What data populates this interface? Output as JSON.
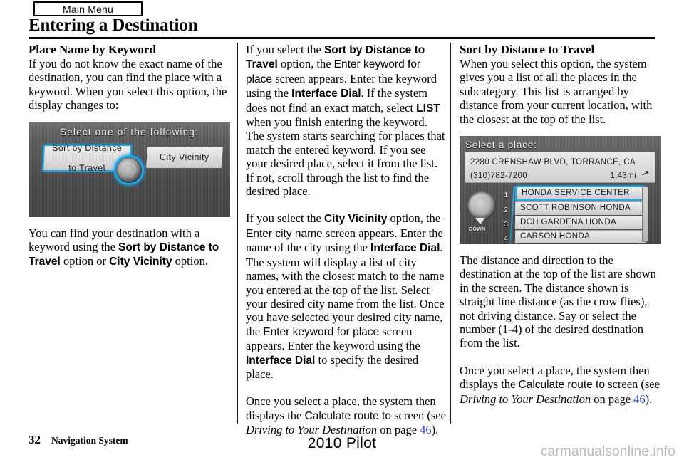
{
  "header": {
    "tab_label": "Main Menu",
    "title": "Entering a Destination"
  },
  "columns": {
    "left": {
      "heading": "Place Name by Keyword",
      "intro": "If you do not know the exact name of the destination, you can find the place with a keyword. When you select this option, the display changes to:",
      "after_1": "You can find your destination with a",
      "after_2": "keyword using the",
      "after_ui_1": "Sort by Distance to Travel",
      "after_3": "option or",
      "after_ui_2": "City Vicinity",
      "after_4": "option."
    },
    "middle": {
      "p1_a": "If you select the",
      "p1_ui1": "Sort by Distance to Travel",
      "p1_b": "option, the",
      "p1_ui2": "Enter keyword for place",
      "p1_c": "screen appears. Enter the keyword using the",
      "p1_ui3": "Interface Dial",
      "p1_d": ". If the system does not find an exact match, select",
      "p1_ui4": "LIST",
      "p1_e": "when you finish entering the keyword. The system starts searching for places that match the entered keyword. If you see your desired place, select it from the list. If not, scroll through the list to find the desired place.",
      "p2_a": "If you select the",
      "p2_ui1": "City Vicinity",
      "p2_b": "option, the",
      "p2_ui2": "Enter city name",
      "p2_c": "screen appears. Enter the name of the city using the",
      "p2_ui3": "Interface Dial",
      "p2_d": ". The system will display a list of city names, with the closest match to the name you entered at the top of the list. Select your desired city name from the list. Once you have selected your desired city name, the",
      "p2_ui4": "Enter keyword for place",
      "p2_e": "screen appears. Enter the keyword using the",
      "p2_ui5": "Interface Dial",
      "p2_f": "to specify the desired place.",
      "p3_a": "Once you select a place, the system then displays the",
      "p3_ui1": "Calculate route to",
      "p3_b": "screen (see",
      "p3_ital": "Driving to Your Destination",
      "p3_c": "on page",
      "p3_link": "46",
      "p3_d": ")."
    },
    "right": {
      "heading": "Sort by Distance to Travel",
      "intro": "When you select this option, the system gives you a list of all the places in the subcategory. This list is arranged by distance from your current location, with the closest at the top of the list.",
      "after": "The distance and direction to the destination at the top of the list are shown in the screen. The distance shown is straight line distance (as the crow flies), not driving distance. Say or select the number (1-4) of the desired destination from the list.",
      "p3_a": "Once you select a place, the system then displays the",
      "p3_ui1": "Calculate route to",
      "p3_b": "screen (see",
      "p3_ital": "Driving to Your Destination",
      "p3_c": "on page",
      "p3_link": "46",
      "p3_d": ")."
    }
  },
  "nav_screen_1": {
    "header": "Select one of the following:",
    "option_left_line1": "Sort by Distance",
    "option_left_line2": "to Travel",
    "option_right": "City Vicinity"
  },
  "nav_screen_2": {
    "header": "Select a place:",
    "address": "2280 CRENSHAW BLVD, TORRANCE, CA",
    "phone": "(310)782-7200",
    "distance": "1,43mi",
    "direction_arrow": "↗",
    "down_label": "DOWN",
    "items": [
      {
        "num": "1",
        "label": "HONDA SERVICE CENTER",
        "selected": true
      },
      {
        "num": "2",
        "label": "SCOTT ROBINSON HONDA",
        "selected": false
      },
      {
        "num": "3",
        "label": "DCH GARDENA HONDA",
        "selected": false
      },
      {
        "num": "4",
        "label": "CARSON HONDA",
        "selected": false
      }
    ]
  },
  "footer": {
    "page_number": "32",
    "section": "Navigation System",
    "model": "2010 Pilot",
    "watermark": "carmanualsonline.info"
  },
  "colors": {
    "link": "#2b43c6",
    "highlight": "#1ea6e8",
    "watermark": "#b9b9b9"
  }
}
